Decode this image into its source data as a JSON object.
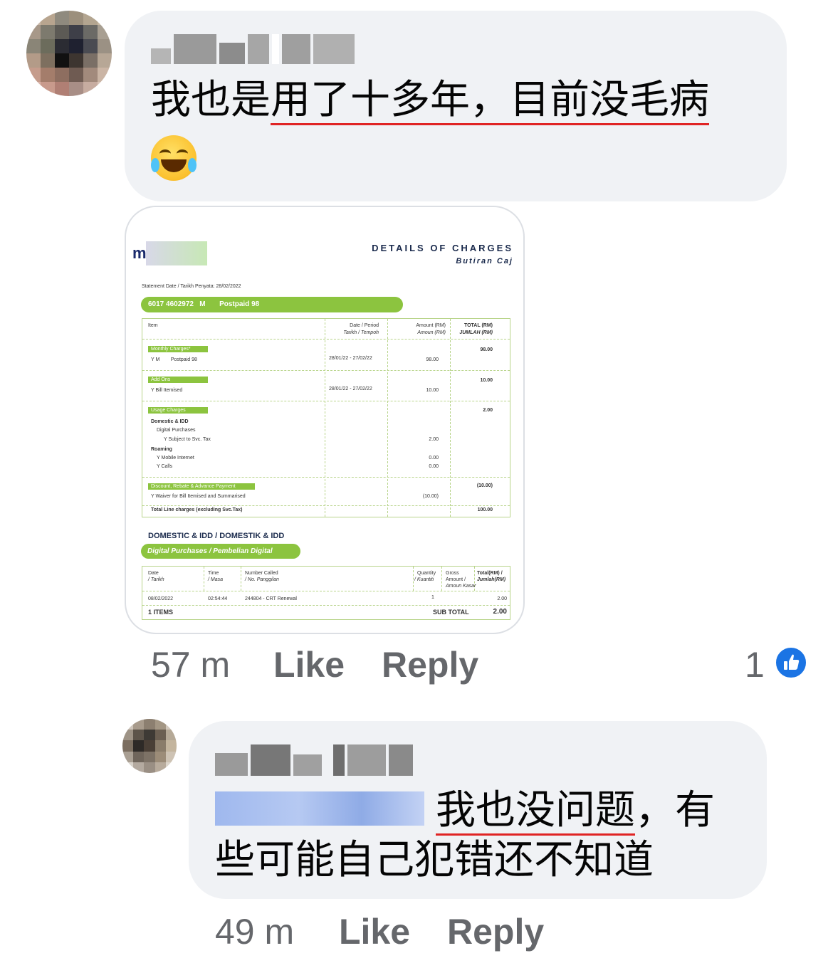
{
  "comment1": {
    "text_line1_plain": "我也是",
    "text_line1_underlined": "用了十多年",
    "text_line1_rest": "，",
    "text_line1_underlined2": "目前没毛病",
    "emoji": "face-with-tears-of-joy-icon",
    "time": "57 m",
    "like_label": "Like",
    "reply_label": "Reply",
    "reaction_count": "1",
    "reaction_icon": "thumbs-up-icon"
  },
  "bill": {
    "brand_initial": "m",
    "title": "DETAILS OF CHARGES",
    "subtitle": "Butiran Caj",
    "statement": "Statement Date / Tarikh Penyata: 28/02/2022",
    "account_pill": "6017 4602972   M       Postpaid 98",
    "headers": {
      "item": "Item",
      "period": "Date / Period",
      "period_ms": "Tarikh / Tempoh",
      "amount": "Amount (RM)",
      "amount_ms": "Amoun (RM)",
      "total": "TOTAL (RM)",
      "total_ms": "JUMLAH (RM)"
    },
    "monthly": {
      "label": "Monthly Charges*",
      "item": "Y M        Postpaid 98",
      "period": "28/01/22 - 27/02/22",
      "amount": "98.00",
      "total": "98.00"
    },
    "addons": {
      "label": "Add Ons",
      "item": "Y Bill Itemised",
      "period": "28/01/22 - 27/02/22",
      "amount": "10.00",
      "total": "10.00"
    },
    "usage": {
      "label": "Usage Charges",
      "total": "2.00",
      "domestic": "Domestic & IDD",
      "digital": "Digital Purchases",
      "subject": "Y Subject to Svc. Tax",
      "subject_amount": "2.00",
      "roaming": "Roaming",
      "mobile": "Y Mobile Internet",
      "mobile_amount": "0.00",
      "calls": "Y Calls",
      "calls_amount": "0.00"
    },
    "discount": {
      "label": "Discount, Rebate & Advance Payment",
      "item": "Y Waiver for Bill Itemised and Summarised",
      "amount": "(10.00)",
      "total": "(10.00)"
    },
    "total_line": {
      "label": "Total Line charges (excluding Svc.Tax)",
      "total": "100.00"
    },
    "section2_title": "DOMESTIC & IDD / DOMESTIK & IDD",
    "section2_pill": "Digital Purchases / Pembelian Digital",
    "t2_headers": {
      "date": "Date",
      "date_ms": "/ Tarikh",
      "time": "Time",
      "time_ms": "/ Masa",
      "number": "Number Called",
      "number_ms": "/ No. Panggilan",
      "qty": "Quantity",
      "qty_ms": "/ Kuantiti",
      "gross": "Gross",
      "gross2": "Amount /",
      "gross_ms": "Amoun Kasar",
      "total": "Total(RM) /",
      "total_ms": "Jumlah(RM)"
    },
    "t2_row": {
      "date": "08/02/2022",
      "time": "02:54:44",
      "number": "244804 - CRT Renewal",
      "qty": "1",
      "total": "2.00"
    },
    "t2_footer": {
      "items": "1 ITEMS",
      "sub_label": "SUB TOTAL",
      "sub_total": "2.00"
    }
  },
  "comment2": {
    "text_underlined": "我也没问题",
    "text_rest1": "，有",
    "text_line2": "些可能自己犯错还不知道",
    "time": "49 m",
    "like_label": "Like",
    "reply_label": "Reply"
  }
}
